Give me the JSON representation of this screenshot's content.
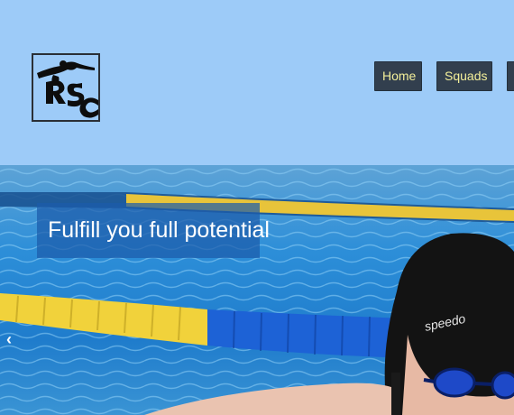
{
  "header": {
    "logo_icon": "swimming-club-logo-icon"
  },
  "nav": {
    "items": [
      {
        "label": "Home"
      },
      {
        "label": "Squads"
      },
      {
        "label": ""
      }
    ]
  },
  "carousel": {
    "caption": "Fulfill you full potential",
    "prev_icon": "chevron-left-icon",
    "prev_glyph": "‹",
    "swim_cap_text": "speedo"
  },
  "colors": {
    "header_bg": "#9dcbf8",
    "nav_bg": "#323f4e",
    "nav_text": "#f3ef9a"
  }
}
